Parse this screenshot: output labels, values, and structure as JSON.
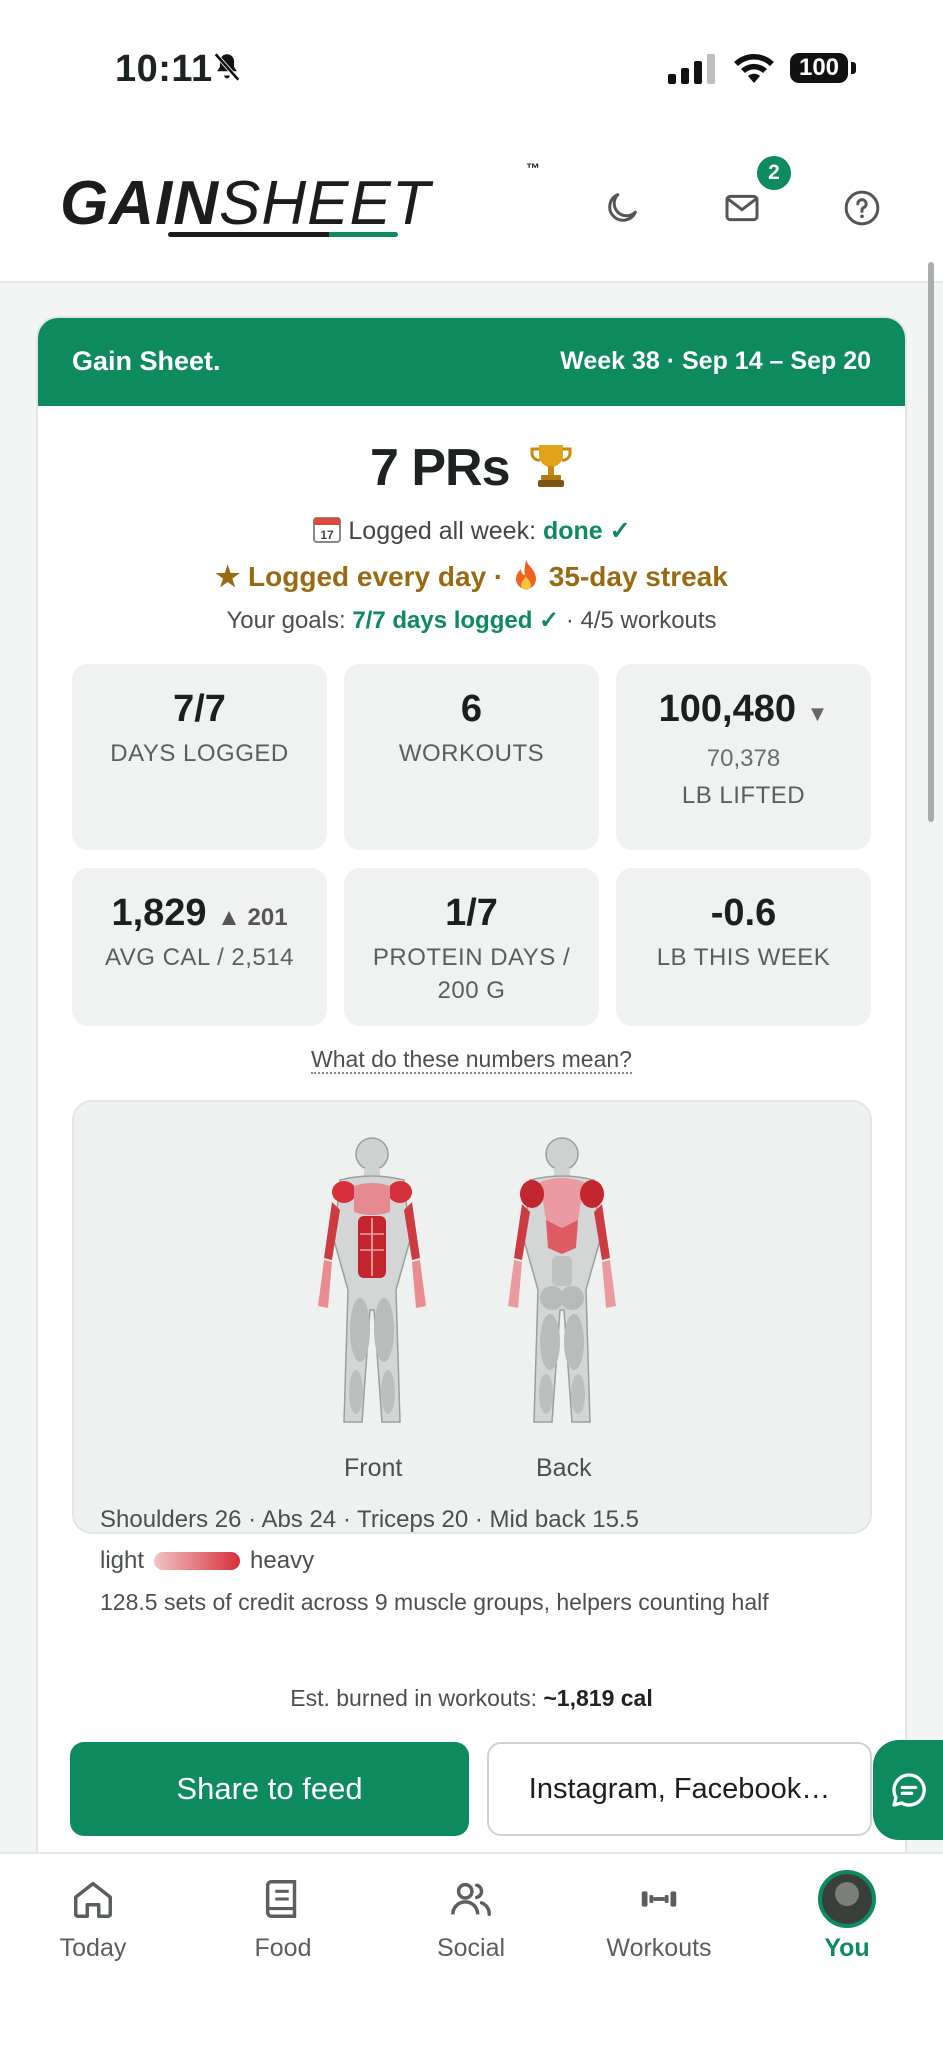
{
  "status": {
    "time": "10:11",
    "battery": "100"
  },
  "header": {
    "logo_bold": "GAIN",
    "logo_light": "SHEET",
    "logo_tm": "™",
    "mail_badge": "2",
    "icons": [
      "moon-icon",
      "mail-icon",
      "help-icon"
    ]
  },
  "card": {
    "brand": "Gain Sheet.",
    "week": "Week 38 · Sep 14 – Sep 20",
    "headline": "7 PRs",
    "logged_prefix": "Logged all week: ",
    "logged_status": "done ✓",
    "streak": "★ Logged every day · ",
    "streak_suffix": " 35-day streak",
    "goals_prefix": "Your goals: ",
    "goals_ok": "7/7 days logged ✓",
    "goals_rest": " · 4/5 workouts",
    "stats": [
      {
        "value": "7/7",
        "label": "DAYS LOGGED"
      },
      {
        "value": "6",
        "label": "WORKOUTS"
      },
      {
        "value": "100,480",
        "delta": "▼",
        "sub": "70,378",
        "label": "LB LIFTED"
      },
      {
        "value": "1,829",
        "delta": "▲ 201",
        "label": "AVG CAL / 2,514"
      },
      {
        "value": "1/7",
        "label": "PROTEIN DAYS / 200 G"
      },
      {
        "value": "-0.6",
        "label": "LB THIS WEEK"
      }
    ],
    "info_link": "What do these numbers mean?",
    "muscles": {
      "front_label": "Front",
      "back_label": "Back",
      "list": "Shoulders 26 · Abs 24 · Triceps 20 · Mid back 15.5",
      "legend_light": "light",
      "legend_heavy": "heavy",
      "credit": "128.5 sets of credit across 9 muscle groups, helpers counting half"
    },
    "burned_prefix": "Est. burned in workouts: ",
    "burned_value": "~1,819 cal",
    "share_button": "Share to feed",
    "social_button": "Instagram, Facebook…"
  },
  "colors": {
    "brand": "#0e8a5f",
    "streak": "#9a6a12",
    "muscle": "#d6303a"
  },
  "tabs": [
    {
      "label": "Today",
      "icon": "home-icon"
    },
    {
      "label": "Food",
      "icon": "book-icon"
    },
    {
      "label": "Social",
      "icon": "people-icon"
    },
    {
      "label": "Workouts",
      "icon": "dumbbell-icon"
    },
    {
      "label": "You",
      "icon": "avatar"
    }
  ]
}
